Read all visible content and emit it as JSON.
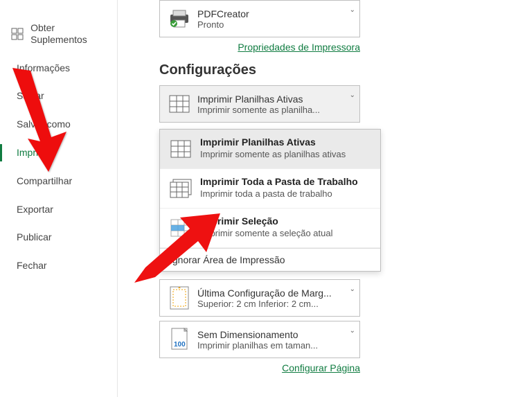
{
  "sidebar": {
    "items": [
      {
        "label": "Obter Suplementos"
      },
      {
        "label": "Informações"
      },
      {
        "label": "Salvar"
      },
      {
        "label": "Salvar como"
      },
      {
        "label": "Imprimir"
      },
      {
        "label": "Compartilhar"
      },
      {
        "label": "Exportar"
      },
      {
        "label": "Publicar"
      },
      {
        "label": "Fechar"
      }
    ]
  },
  "printer": {
    "name": "PDFCreator",
    "status": "Pronto",
    "properties_link": "Propriedades de Impressora"
  },
  "settings": {
    "heading": "Configurações",
    "selected": {
      "title": "Imprimir Planilhas Ativas",
      "sub": "Imprimir somente as planilha..."
    },
    "options": [
      {
        "title": "Imprimir Planilhas Ativas",
        "sub": "Imprimir somente as planilhas ativas"
      },
      {
        "title": "Imprimir Toda a Pasta de Trabalho",
        "sub": "Imprimir toda a pasta de trabalho"
      },
      {
        "title": "Imprimir Seleção",
        "sub": "Imprimir somente a seleção atual"
      }
    ],
    "ignore_area": "Ignorar Área de Impressão",
    "margins": {
      "title": "Última Configuração de Marg...",
      "sub": "Superior: 2 cm Inferior: 2 cm..."
    },
    "scaling": {
      "title": "Sem Dimensionamento",
      "sub": "Imprimir planilhas em taman..."
    },
    "page_setup_link": "Configurar Página"
  }
}
